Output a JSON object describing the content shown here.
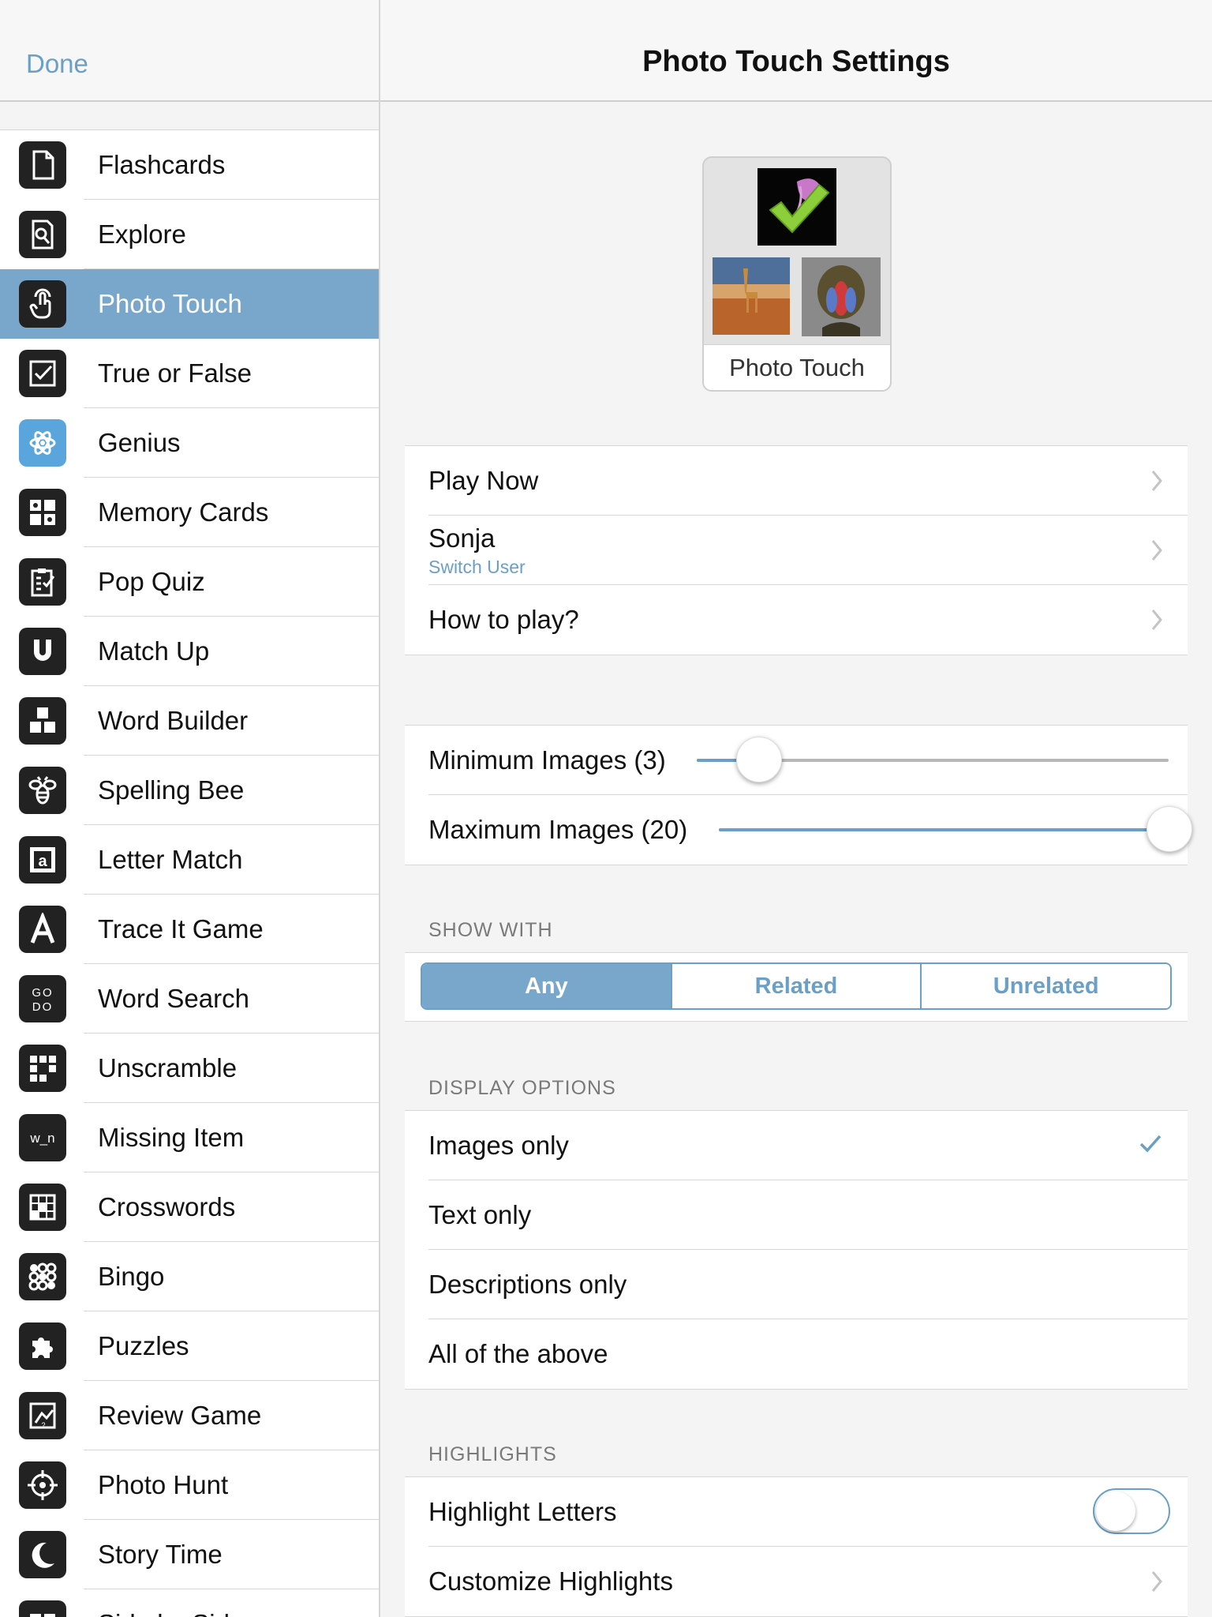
{
  "sidebar": {
    "done_label": "Done",
    "items": [
      {
        "label": "Flashcards",
        "icon": "document-icon"
      },
      {
        "label": "Explore",
        "icon": "magnifier-document-icon"
      },
      {
        "label": "Photo Touch",
        "icon": "touch-hand-icon",
        "selected": true
      },
      {
        "label": "True or False",
        "icon": "checkbox-icon"
      },
      {
        "label": "Genius",
        "icon": "atom-icon"
      },
      {
        "label": "Memory Cards",
        "icon": "card-grid-icon"
      },
      {
        "label": "Pop Quiz",
        "icon": "clipboard-check-icon"
      },
      {
        "label": "Match Up",
        "icon": "magnet-icon"
      },
      {
        "label": "Word Builder",
        "icon": "blocks-icon"
      },
      {
        "label": "Spelling Bee",
        "icon": "bee-icon"
      },
      {
        "label": "Letter Match",
        "icon": "letter-a-stamp-icon"
      },
      {
        "label": "Trace It Game",
        "icon": "letter-a-trace-icon"
      },
      {
        "label": "Word Search",
        "icon": "letters-grid-icon",
        "icon_text": "GO DO"
      },
      {
        "label": "Unscramble",
        "icon": "tile-grid-icon"
      },
      {
        "label": "Missing Item",
        "icon": "missing-letter-icon",
        "icon_text": "w_n"
      },
      {
        "label": "Crosswords",
        "icon": "crossword-icon"
      },
      {
        "label": "Bingo",
        "icon": "bingo-icon"
      },
      {
        "label": "Puzzles",
        "icon": "puzzle-piece-icon"
      },
      {
        "label": "Review Game",
        "icon": "review-game-icon"
      },
      {
        "label": "Photo Hunt",
        "icon": "crosshair-icon"
      },
      {
        "label": "Story Time",
        "icon": "moon-icon"
      },
      {
        "label": "Side by Side",
        "icon": "side-by-side-icon"
      }
    ]
  },
  "main": {
    "title": "Photo Touch Settings",
    "tile_label": "Photo Touch",
    "actions": {
      "play_now": "Play Now",
      "user_name": "Sonja",
      "switch_user": "Switch User",
      "how_to_play": "How to play?"
    },
    "sliders": {
      "min_label": "Minimum Images (3)",
      "min_value": 3,
      "max_label": "Maximum Images (20)",
      "max_value": 20,
      "range": [
        3,
        20
      ]
    },
    "show_with": {
      "header": "SHOW WITH",
      "options": [
        "Any",
        "Related",
        "Unrelated"
      ],
      "selected": "Any"
    },
    "display_options": {
      "header": "DISPLAY OPTIONS",
      "options": [
        "Images only",
        "Text only",
        "Descriptions only",
        "All of the above"
      ],
      "selected": "Images only"
    },
    "highlights": {
      "header": "HIGHLIGHTS",
      "highlight_letters": "Highlight Letters",
      "highlight_letters_on": false,
      "customize": "Customize Highlights"
    }
  },
  "colors": {
    "accent": "#6a9fc8",
    "selected_row": "#79a7cc",
    "icon_bg": "#222222",
    "genius_icon_bg": "#5aa6dc"
  }
}
